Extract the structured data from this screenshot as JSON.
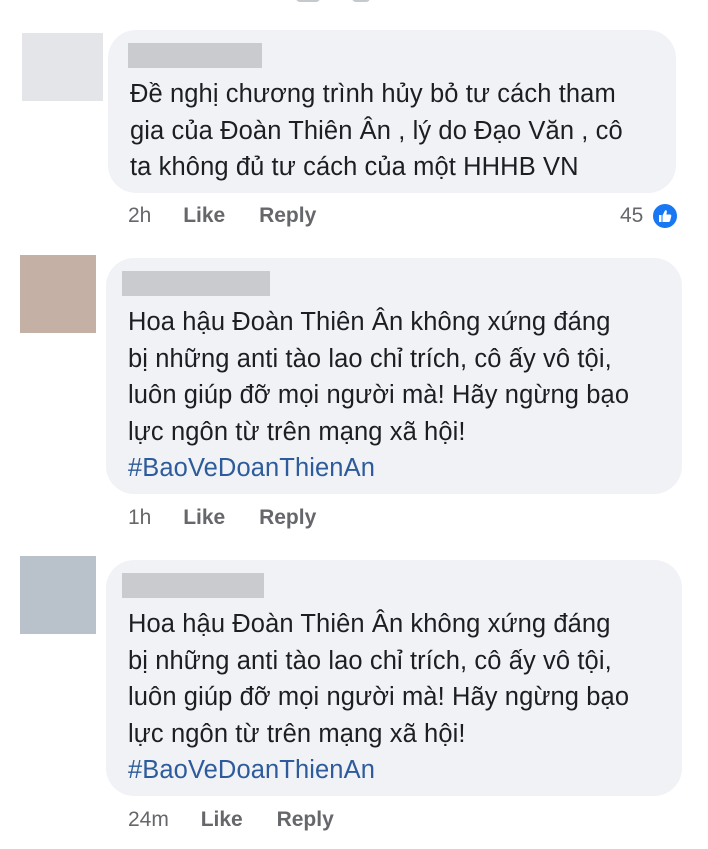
{
  "colors": {
    "bubble": "#f0f2f5",
    "redaction": "#c9cbce",
    "hashtag": "#2d5b9b",
    "meta_text": "#65676b",
    "like_blue": "#1877f2"
  },
  "comments": [
    {
      "avatar_color": "#e4e5e8",
      "lines": [
        "Đề nghị chương trình hủy bỏ tư cách tham",
        "gia của Đoàn Thiên Ân , lý do Đạo Văn , cô",
        "ta không đủ tư cách của một HHHB VN"
      ],
      "hashtag": "",
      "time": "2h",
      "like_label": "Like",
      "reply_label": "Reply",
      "reaction_count": "45",
      "reaction_icon": "thumbs-up-icon"
    },
    {
      "avatar_color": "#c5b0a6",
      "lines": [
        "Hoa hậu Đoàn Thiên Ân không xứng đáng",
        "bị những anti tào lao chỉ trích, cô ấy vô tội,",
        "luôn giúp đỡ mọi người mà! Hãy ngừng bạo",
        "lực ngôn từ trên mạng xã hội!"
      ],
      "hashtag": "#BaoVeDoanThienAn",
      "time": "1h",
      "like_label": "Like",
      "reply_label": "Reply"
    },
    {
      "avatar_color": "#b9c1cb",
      "lines": [
        "Hoa hậu Đoàn Thiên Ân không xứng đáng",
        "bị những anti tào lao chỉ trích, cô ấy vô tội,",
        "luôn giúp đỡ mọi người mà! Hãy ngừng bạo",
        "lực ngôn từ trên mạng xã hội!"
      ],
      "hashtag": "#BaoVeDoanThienAn",
      "time": "24m",
      "like_label": "Like",
      "reply_label": "Reply"
    }
  ]
}
